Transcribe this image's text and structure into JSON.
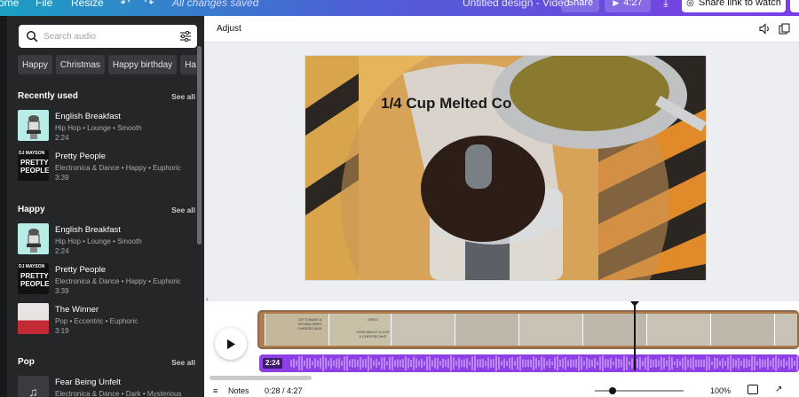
{
  "topbar": {
    "home_label": "ome",
    "file_label": "File",
    "resize_label": "Resize",
    "saved_status": "All changes saved",
    "design_title": "Untitled design - Video",
    "share_label": "Share",
    "play_time": "4:27",
    "share_link_label": "Share link to watch"
  },
  "sidebar": {
    "search_placeholder": "Search audio",
    "chips": [
      "Happy",
      "Christmas",
      "Happy birthday",
      "Ha"
    ],
    "sections": [
      {
        "title": "Recently used",
        "see_all": "See all",
        "tracks": [
          {
            "name": "English Breakfast",
            "meta": "Hip Hop • Lounge • Smooth",
            "duration": "2:24"
          },
          {
            "name": "Pretty People",
            "meta": "Electronica & Dance • Happy • Euphoric",
            "duration": "3:39"
          }
        ]
      },
      {
        "title": "Happy",
        "see_all": "See all",
        "tracks": [
          {
            "name": "English Breakfast",
            "meta": "Hip Hop • Lounge • Smooth",
            "duration": "2:24"
          },
          {
            "name": "Pretty People",
            "meta": "Electronica & Dance • Happy • Euphoric",
            "duration": "3:39"
          },
          {
            "name": "The Winner",
            "meta": "Pop • Eccentric • Euphoric",
            "duration": "3:19"
          }
        ]
      },
      {
        "title": "Pop",
        "see_all": "See all",
        "tracks": [
          {
            "name": "Fear Being Unfelt",
            "meta": "Electronica & Dance • Dark • Mysterious",
            "duration": ""
          }
        ]
      }
    ],
    "thumb_text": {
      "dj": "DJ MAYSON",
      "pretty": "PRETTY",
      "people": "PEOPLE"
    }
  },
  "editor": {
    "adjust_label": "Adjust",
    "canvas_caption": "1/4 Cup Melted Co"
  },
  "timeline": {
    "audio_duration": "2:24",
    "clip_text_1": "LET'S MAKE A VEGAN OREO CHEESECAKE",
    "clip_text_2": "OREO",
    "clip_text_3": "HOW ABOUT A CUP & CHEESECAKE"
  },
  "bottombar": {
    "notes_label": "Notes",
    "time_display": "0:28 / 4:27",
    "zoom_label": "100%"
  },
  "colors": {
    "panel_bg": "#252627",
    "audio_track": "#8e3fe6",
    "topbar_start": "#1c9fc2",
    "topbar_end": "#7d3be6"
  }
}
